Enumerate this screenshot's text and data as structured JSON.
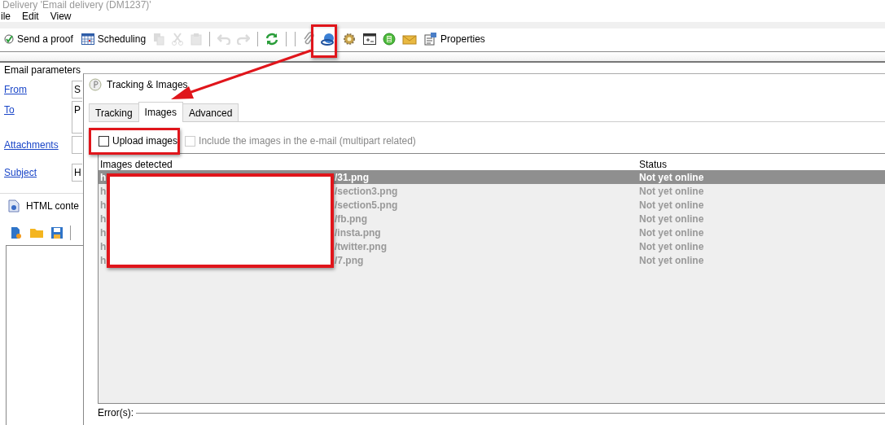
{
  "window": {
    "title": "Delivery 'Email delivery (DM1237)'"
  },
  "menu": [
    "ile",
    "Edit",
    "View"
  ],
  "toolbar": [
    {
      "kind": "text",
      "label": "Send a proof",
      "disabled": false
    },
    {
      "kind": "text",
      "label": "Scheduling",
      "disabled": false
    },
    {
      "kind": "icon",
      "disabled": true
    },
    {
      "kind": "icon",
      "disabled": true
    },
    {
      "kind": "icon",
      "disabled": true
    },
    {
      "kind": "separator"
    },
    {
      "kind": "icon",
      "disabled": true
    },
    {
      "kind": "icon",
      "disabled": true
    },
    {
      "kind": "separator"
    },
    {
      "kind": "icon",
      "disabled": false
    },
    {
      "kind": "separator"
    },
    {
      "kind": "separator"
    },
    {
      "kind": "icon",
      "disabled": false
    },
    {
      "kind": "icon",
      "disabled": false
    },
    {
      "kind": "icon",
      "disabled": false
    },
    {
      "kind": "icon",
      "disabled": false
    },
    {
      "kind": "icon",
      "disabled": false
    },
    {
      "kind": "icon",
      "disabled": false
    },
    {
      "kind": "text",
      "label": "Properties",
      "disabled": false
    }
  ],
  "email_parameters": {
    "title": "Email parameters",
    "fields": [
      {
        "label": "From",
        "value": "S"
      },
      {
        "label": "To",
        "value": "P"
      },
      {
        "label": "Attachments"
      },
      {
        "label": "Subject",
        "value": "H"
      }
    ]
  },
  "html_content": {
    "label": "HTML conte"
  },
  "dialog": {
    "title": "Tracking & Images",
    "tabs": [
      {
        "label": "Tracking",
        "selected": false
      },
      {
        "label": "Images",
        "selected": true
      },
      {
        "label": "Advanced",
        "selected": false
      }
    ],
    "options": [
      {
        "label": "Upload images",
        "checked": false,
        "disabled": false
      },
      {
        "label": "Include the images in the e-mail (multipart related)",
        "checked": false,
        "disabled": true
      }
    ],
    "list": {
      "columns": [
        "Images detected",
        "Status"
      ],
      "rows": [
        {
          "url_start": "h",
          "url_end": "/31.png",
          "status": "Not yet online",
          "selected": true
        },
        {
          "url_start": "h",
          "url_end": "/section3.png",
          "status": "Not yet online",
          "selected": false
        },
        {
          "url_start": "h",
          "url_end": "/section5.png",
          "status": "Not yet online",
          "selected": false
        },
        {
          "url_start": "h",
          "url_end": "/fb.png",
          "status": "Not yet online",
          "selected": false
        },
        {
          "url_start": "h",
          "url_end": "/insta.png",
          "status": "Not yet online",
          "selected": false
        },
        {
          "url_start": "h",
          "url_end": "/twitter.png",
          "status": "Not yet online",
          "selected": false
        },
        {
          "url_start": "h",
          "url_end": "/7.png",
          "status": "Not yet online",
          "selected": false
        }
      ]
    },
    "errors_label": "Error(s):"
  }
}
